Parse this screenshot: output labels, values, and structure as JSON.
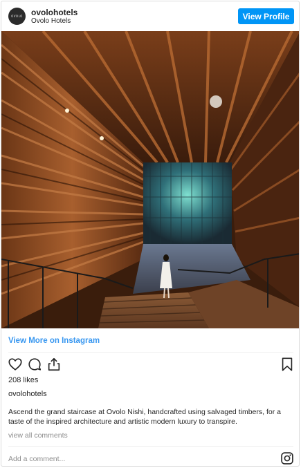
{
  "header": {
    "avatar_text": "OVOLO",
    "username": "ovolohotels",
    "full_name": "Ovolo Hotels",
    "view_profile_label": "View Profile"
  },
  "post": {
    "view_more_label": "View More on Instagram",
    "likes_text": "208 likes",
    "caption_username": "ovolohotels",
    "caption_text": "Ascend the grand staircase at Ovolo Nishi, handcrafted using salvaged timbers, for a taste of the inspired architecture and artistic modern luxury to transpire.",
    "view_comments_label": "view all comments"
  },
  "comment": {
    "placeholder": "Add a comment..."
  },
  "icons": {
    "like": "heart-icon",
    "comment": "comment-icon",
    "share": "share-icon",
    "save": "bookmark-icon",
    "instagram": "instagram-icon"
  },
  "colors": {
    "accent": "#0095f6",
    "link": "#3897f0",
    "muted": "#8e8e8e"
  }
}
